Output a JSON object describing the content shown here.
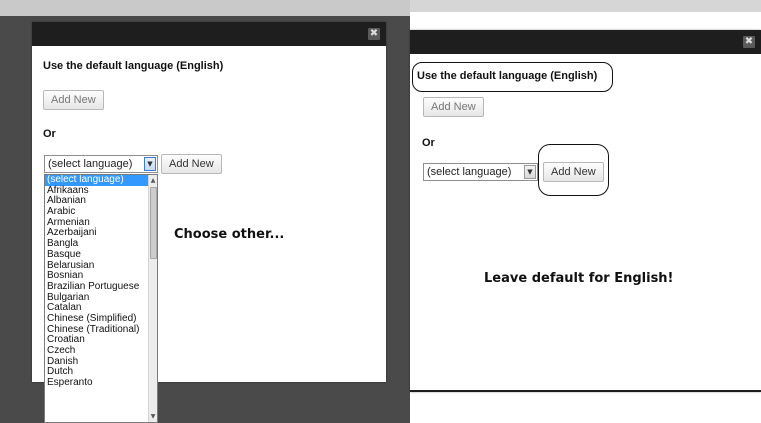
{
  "left": {
    "default_heading": "Use the default language (English)",
    "add_new_default": "Add New",
    "or_label": "Or",
    "select_value": "(select language)",
    "add_new_lang": "Add New",
    "annotation": "Choose other...",
    "close_glyph": "✖",
    "dropdown_options": [
      "(select language)",
      "Afrikaans",
      "Albanian",
      "Arabic",
      "Armenian",
      "Azerbaijani",
      "Bangla",
      "Basque",
      "Belarusian",
      "Bosnian",
      "Brazilian Portuguese",
      "Bulgarian",
      "Catalan",
      "Chinese (Simplified)",
      "Chinese (Traditional)",
      "Croatian",
      "Czech",
      "Danish",
      "Dutch",
      "Esperanto"
    ]
  },
  "right": {
    "default_heading": "Use the default language (English)",
    "add_new_default": "Add New",
    "or_label": "Or",
    "select_value": "(select language)",
    "add_new_lang": "Add New",
    "annotation": "Leave default for English!",
    "close_glyph": "✖"
  },
  "colors": {
    "dialog_bar": "#1e1e1e",
    "backdrop": "#4a4a4a",
    "selected_option": "#3399ff"
  }
}
